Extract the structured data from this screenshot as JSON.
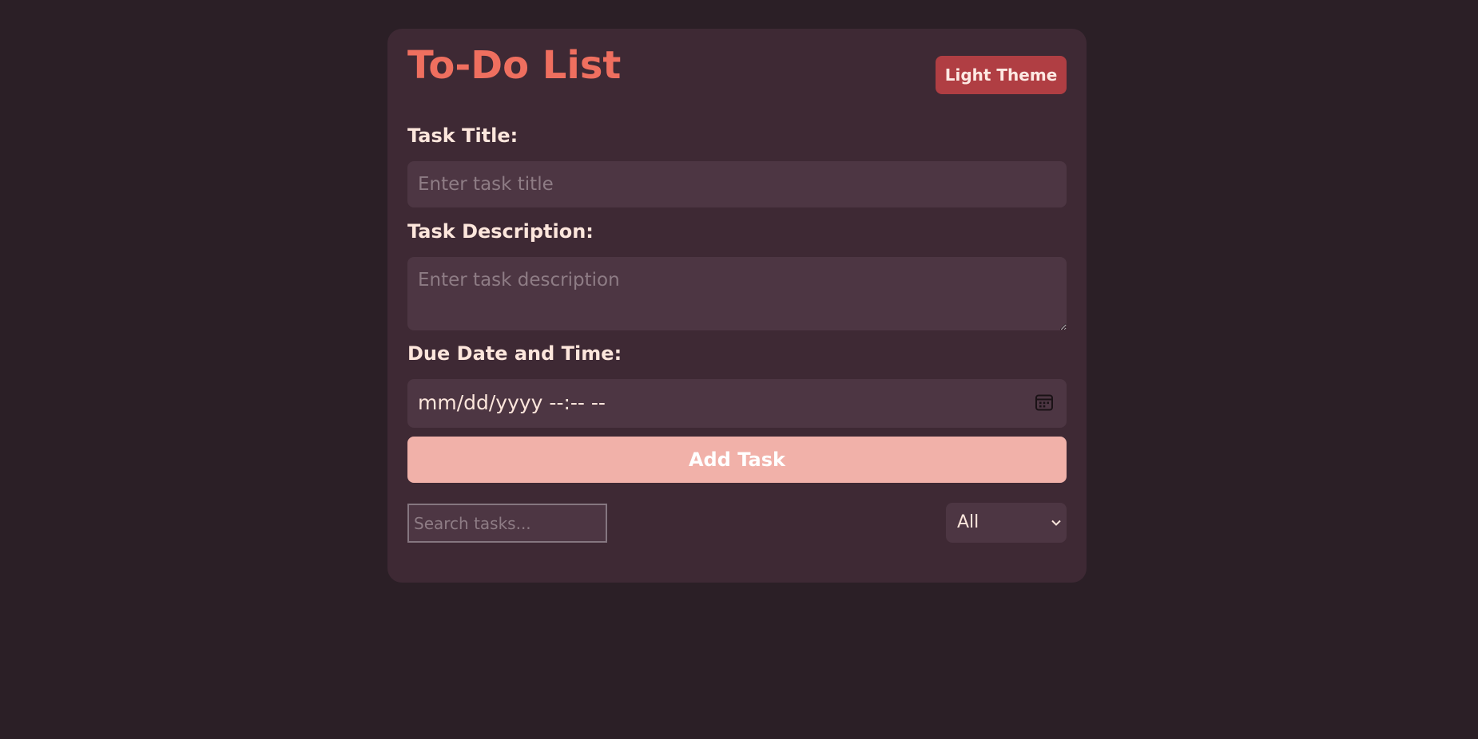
{
  "app": {
    "title": "To-Do List",
    "theme_button_label": "Light Theme"
  },
  "form": {
    "title_label": "Task Title:",
    "title_placeholder": "Enter task title",
    "title_value": "",
    "description_label": "Task Description:",
    "description_placeholder": "Enter task description",
    "description_value": "",
    "due_label": "Due Date and Time:",
    "due_value": "mm/dd/yyyy --:-- --",
    "add_button_label": "Add Task"
  },
  "controls": {
    "search_placeholder": "Search tasks...",
    "search_value": "",
    "filter_selected": "All"
  },
  "icons": {
    "calendar": "calendar-icon",
    "filter_dropdown": "chevron-down-icon"
  },
  "colors": {
    "background": "#2b1f26",
    "card": "#3e2934",
    "title_accent": "#ef6f5f",
    "theme_button": "#b03e43",
    "add_button": "#f1b1a9"
  }
}
